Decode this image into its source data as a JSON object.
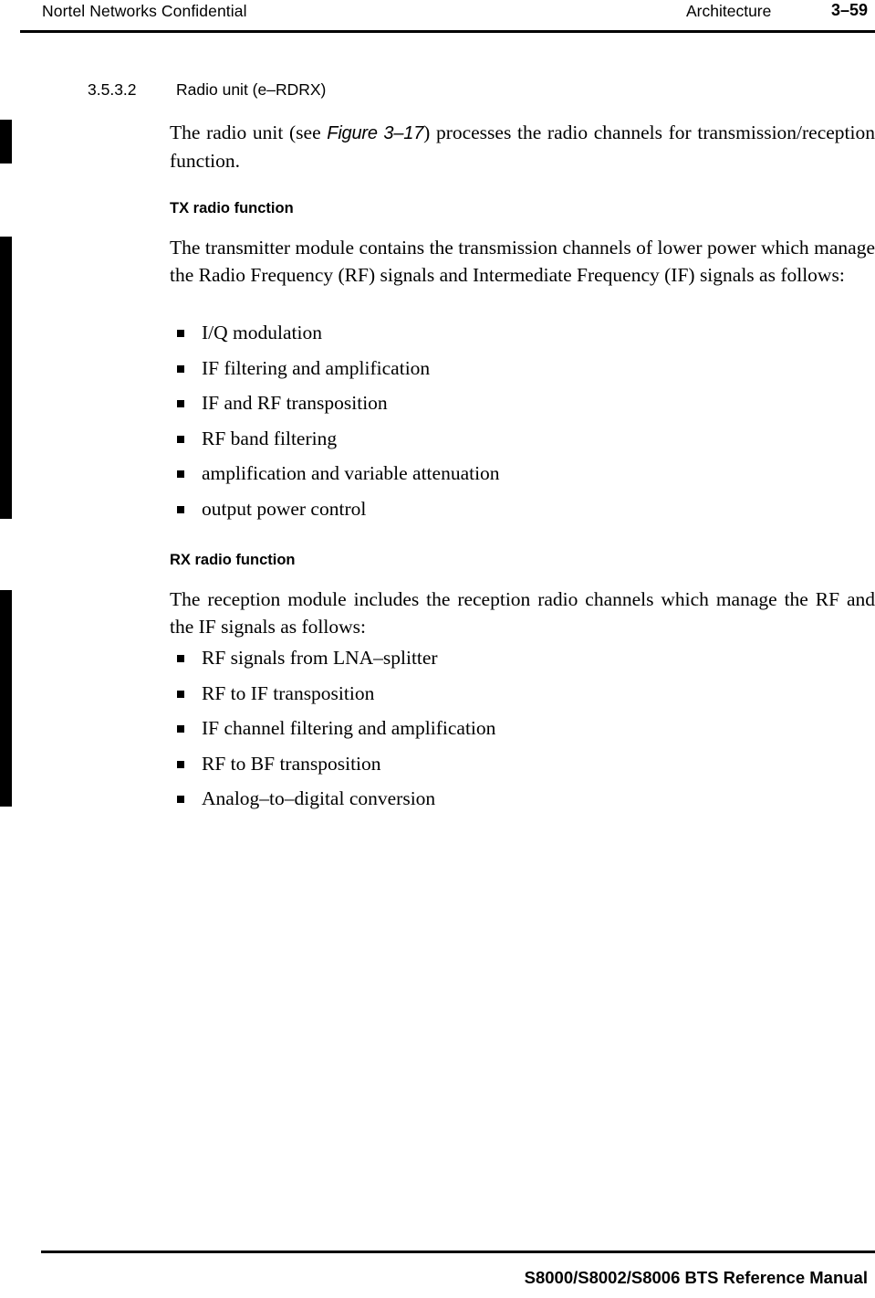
{
  "header": {
    "confidential_label": "Nortel Networks Confidential",
    "chapter_title": "Architecture",
    "page_number": "3–59"
  },
  "section": {
    "number": "3.5.3.2",
    "title": "Radio unit (e–RDRX)"
  },
  "intro": {
    "text_before_figref": "The radio unit (see ",
    "figure_reference": "Figure 3–17",
    "text_after_figref": ") processes the radio channels for transmission/reception function."
  },
  "tx_section": {
    "heading": "TX radio function",
    "paragraph": "The transmitter module contains the transmission channels of lower power which manage the Radio Frequency (RF) signals and Intermediate Frequency (IF) signals as follows:",
    "bullets": [
      "I/Q modulation",
      "IF filtering and amplification",
      "IF and RF transposition",
      "RF band filtering",
      "amplification and variable attenuation",
      "output power control"
    ]
  },
  "rx_section": {
    "heading": "RX radio function",
    "paragraph": "The reception module includes the reception radio channels which manage the RF and the IF signals as follows:",
    "bullets": [
      "RF signals from LNA–splitter",
      "RF to IF transposition",
      "IF channel filtering and amplification",
      "RF to BF transposition",
      "Analog–to–digital conversion"
    ]
  },
  "footer": {
    "manual_title": "S8000/S8002/S8006 BTS Reference Manual"
  },
  "change_bars": {
    "count": 3,
    "color": "#000000"
  }
}
